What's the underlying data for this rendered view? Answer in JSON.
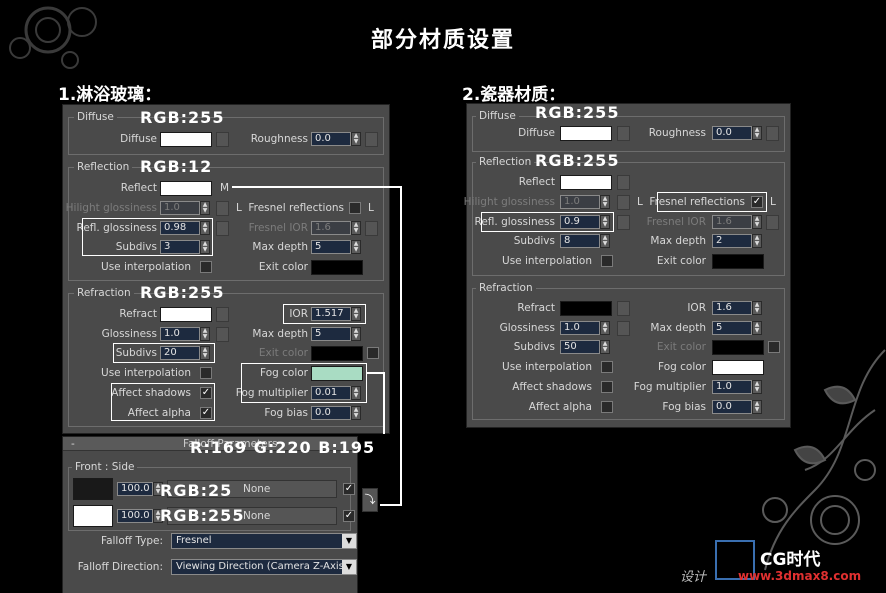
{
  "page_title": "部分材质设置",
  "sections": {
    "s1": "1.淋浴玻璃：",
    "s2": "2.瓷器材质："
  },
  "labels": {
    "diffuse": "Diffuse",
    "reflection": "Reflection",
    "refraction": "Refraction",
    "roughness": "Roughness",
    "reflect": "Reflect",
    "hilight": "Hilight glossiness",
    "refl_gloss": "Refl. glossiness",
    "subdivs": "Subdivs",
    "use_interp": "Use interpolation",
    "fresnel": "Fresnel reflections",
    "fresnel_ior": "Fresnel IOR",
    "max_depth": "Max depth",
    "exit_color": "Exit color",
    "refract": "Refract",
    "glossiness": "Glossiness",
    "ior": "IOR",
    "fog_color": "Fog color",
    "fog_mult": "Fog multiplier",
    "fog_bias": "Fog bias",
    "affect_shadows": "Affect shadows",
    "affect_alpha": "Affect alpha",
    "m_button": "M",
    "l_button": "L"
  },
  "glass": {
    "ann_diffuse": "RGB:255",
    "ann_reflect": "RGB:12",
    "ann_refract": "RGB:255",
    "ann_fog": "R:169 G:220 B:195",
    "roughness": "0.0",
    "hilight": "1.0",
    "refl_gloss": "0.98",
    "subdivs": "3",
    "fresnel_ior": "1.6",
    "max_depth": "5",
    "r_gloss": "1.0",
    "r_subdivs": "20",
    "ior": "1.517",
    "r_max_depth": "5",
    "fog_mult": "0.01",
    "fog_bias": "0.0",
    "colors": {
      "diffuse": "#ffffff",
      "reflect": "#ffffff",
      "refract": "#ffffff",
      "exit": "#000000",
      "r_exit": "#000000",
      "fog": "#a9dcc3"
    }
  },
  "falloff": {
    "header_minus": "-",
    "header_title": "Falloff Parameters",
    "front_side": "Front : Side",
    "v1": "100.0",
    "v2": "100.0",
    "none1": "None",
    "none2": "None",
    "ann1": "RGB:25",
    "ann2": "RGB:255",
    "type_label": "Falloff Type:",
    "type_value": "Fresnel",
    "dir_label": "Falloff Direction:",
    "dir_value": "Viewing Direction (Camera Z-Axis)",
    "colors": {
      "c1": "#191919",
      "c2": "#ffffff"
    }
  },
  "porcelain": {
    "ann_diffuse": "RGB:255",
    "ann_reflect": "RGB:255",
    "roughness": "0.0",
    "hilight": "1.0",
    "refl_gloss": "0.9",
    "subdivs": "8",
    "fresnel_ior": "1.6",
    "max_depth": "2",
    "r_gloss": "1.0",
    "r_subdivs": "50",
    "ior": "1.6",
    "r_max_depth": "5",
    "fog_mult": "1.0",
    "fog_bias": "0.0",
    "colors": {
      "diffuse": "#ffffff",
      "reflect": "#ffffff",
      "refract": "#000000",
      "exit": "#000000",
      "r_exit": "#000000",
      "fog": "#ffffff"
    }
  },
  "watermark": {
    "logo": "CG时代",
    "url": "www.3dmax8.com",
    "design": "设计"
  }
}
